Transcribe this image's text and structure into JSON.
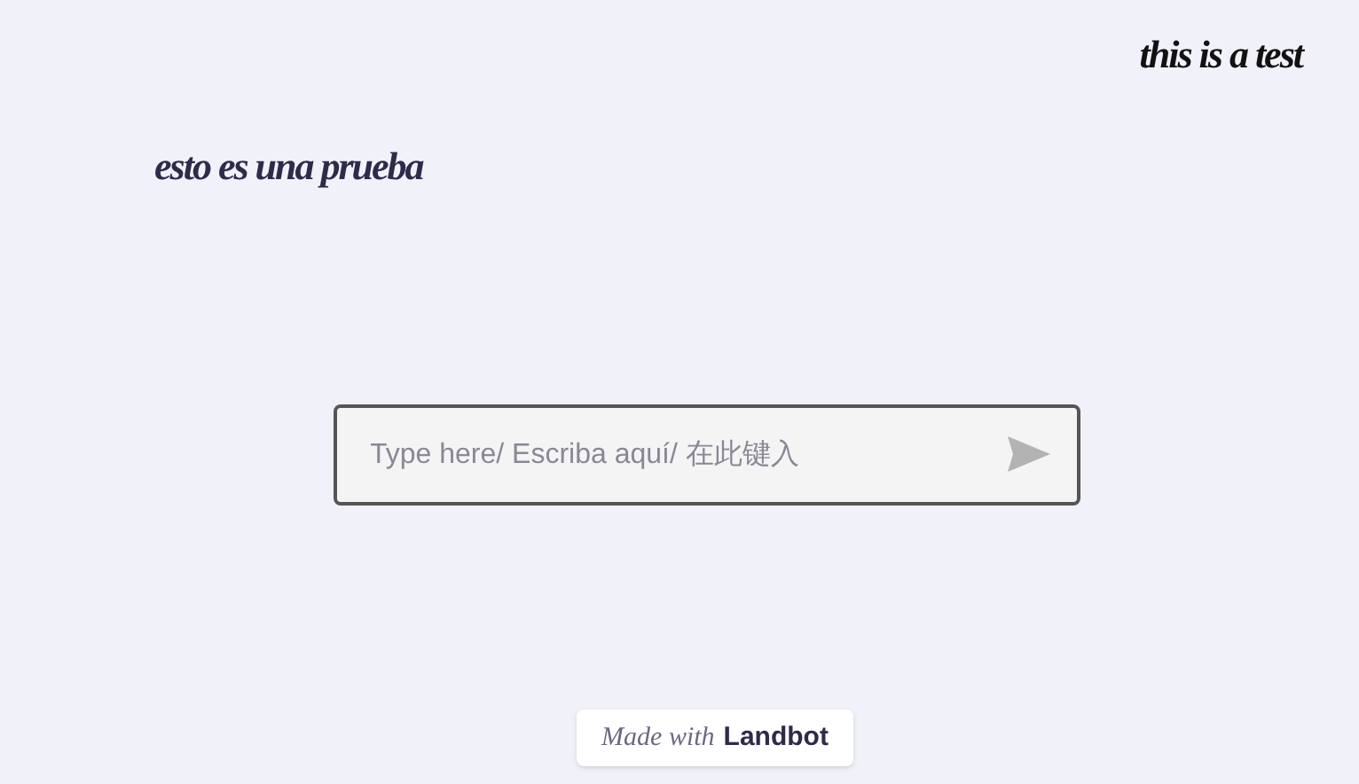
{
  "messages": [
    {
      "text": "this is a test",
      "kind": "user"
    },
    {
      "text": "esto es una prueba",
      "kind": "bot"
    }
  ],
  "input": {
    "placeholder": "Type here/ Escriba aquí/ 在此键入"
  },
  "badge": {
    "prefix": "Made with",
    "brand": "Landbot"
  }
}
